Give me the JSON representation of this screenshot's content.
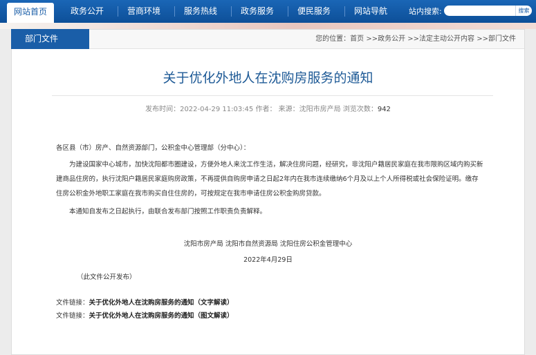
{
  "nav": {
    "items": [
      "网站首页",
      "政务公开",
      "营商环境",
      "服务热线",
      "政务服务",
      "便民服务",
      "网站导航"
    ],
    "search_label": "站内搜索:",
    "search_placeholder": "",
    "search_button": "搜索"
  },
  "header": {
    "dept_tab": "部门文件",
    "breadcrumb": "您的位置：首页 >>政务公开 >>法定主动公开内容 >>部门文件"
  },
  "article": {
    "title": "关于优化外地人在沈购房服务的通知",
    "meta_prefix": "发布时间：2022-04-29 11:03:45 作者：  来源：沈阳市房产局 浏览次数：",
    "views": "942",
    "salutation": "各区县（市）房产、自然资源部门，公积金中心管理部（分中心）：",
    "paragraph1": "为建设国家中心城市，加快沈阳都市圈建设，方便外地人来沈工作生活，解决住房问题，经研究，非沈阳户籍居民家庭在我市限购区域内购买新建商品住房的，执行沈阳户籍居民家庭购房政策，不再提供自购房申请之日起2年内在我市连续缴纳6个月及以上个人所得税或社会保险证明。缴存住房公积金外地职工家庭在我市购买自住住房的，可按规定在我市申请住房公积金购房贷款。",
    "paragraph2": "本通知自发布之日起执行，由联合发布部门按照工作职责负责解释。",
    "issuers": "沈阳市房产局  沈阳市自然资源局  沈阳住房公积金管理中心",
    "date": "2022年4月29日",
    "public_note": "（此文件公开发布）"
  },
  "links": [
    {
      "prefix": "文件链接：",
      "text": "关于优化外地人在沈购房服务的通知（文字解读）"
    },
    {
      "prefix": "文件链接：",
      "text": "关于优化外地人在沈购房服务的通知（图文解读）"
    }
  ],
  "colors": {
    "nav_blue": "#0d4f98",
    "title_blue": "#1e5a96"
  }
}
